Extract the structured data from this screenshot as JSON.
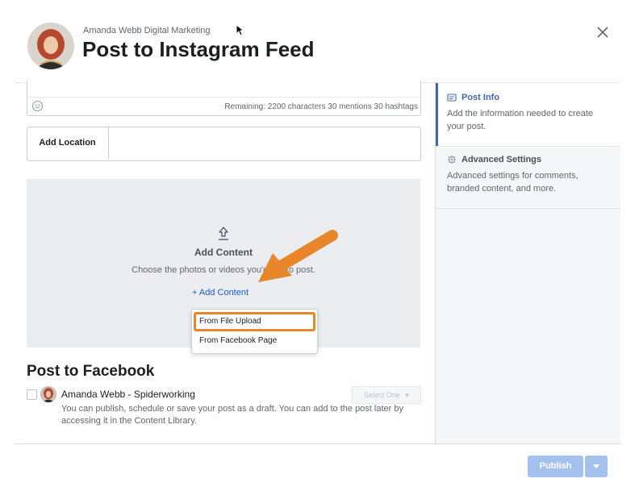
{
  "header": {
    "page_name": "Amanda Webb Digital Marketing",
    "title": "Post to Instagram Feed"
  },
  "caption": {
    "remaining": "Remaining: 2200 characters 30 mentions 30 hashtags"
  },
  "location": {
    "label": "Add Location",
    "value": ""
  },
  "content": {
    "title": "Add Content",
    "description": "Choose the photos or videos you'd like to post.",
    "add_link": "+ Add Content",
    "menu": [
      "From File Upload",
      "From Facebook Page"
    ]
  },
  "facebook": {
    "title": "Post to Facebook",
    "page_name": "Amanda Webb - Spiderworking",
    "select_placeholder": "Select One",
    "description": "You can publish, schedule or save your post as a draft. You can add to the post later by accessing it in the Content Library."
  },
  "sidebar": {
    "items": [
      {
        "title": "Post Info",
        "description": "Add the information needed to create your post.",
        "icon": "document-icon"
      },
      {
        "title": "Advanced Settings",
        "description": "Advanced settings for comments, branded content, and more.",
        "icon": "gear-icon"
      }
    ]
  },
  "footer": {
    "publish_label": "Publish"
  },
  "colors": {
    "accent": "#4267b2",
    "link": "#1c5bc2",
    "annotation": "#e8862b",
    "publish_disabled": "#a4c1ee"
  }
}
